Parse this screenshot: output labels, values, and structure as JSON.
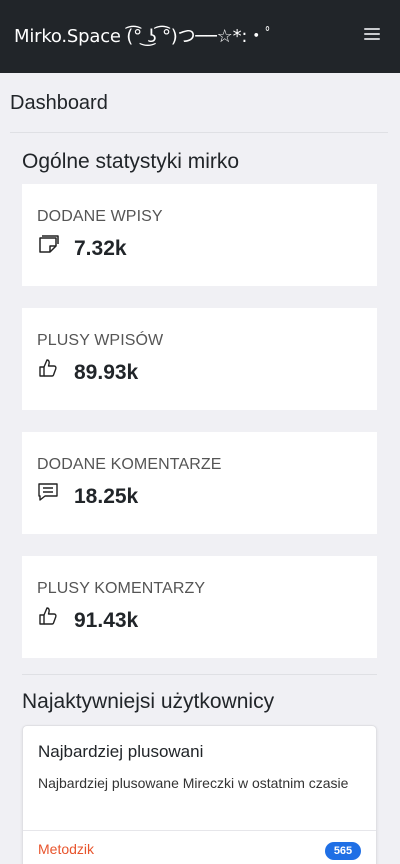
{
  "navbar": {
    "brand": "Mirko.Space (͡° ͜ʖ ͡°)つ──☆*:・ﾟ",
    "menu_icon": "hamburger-icon"
  },
  "page": {
    "title": "Dashboard"
  },
  "stats": {
    "title": "Ogólne statystyki mirko",
    "items": [
      {
        "label": "DODANE WPISY",
        "value": "7.32k",
        "icon": "note-icon"
      },
      {
        "label": "PLUSY WPISÓW",
        "value": "89.93k",
        "icon": "thumbs-up-icon"
      },
      {
        "label": "DODANE KOMENTARZE",
        "value": "18.25k",
        "icon": "comment-icon"
      },
      {
        "label": "PLUSY KOMENTARZY",
        "value": "91.43k",
        "icon": "thumbs-up-icon"
      }
    ]
  },
  "active_users": {
    "title": "Najaktywniejsi użytkownicy",
    "card": {
      "title": "Najbardziej plusowani",
      "description": "Najbardziej plusowane Mireczki w ostatnim czasie",
      "users": [
        {
          "name": "Metodzik",
          "count": "565"
        }
      ]
    }
  },
  "colors": {
    "navbar": "#212529",
    "username": "#e8542c",
    "badge": "#1f6fe5"
  }
}
